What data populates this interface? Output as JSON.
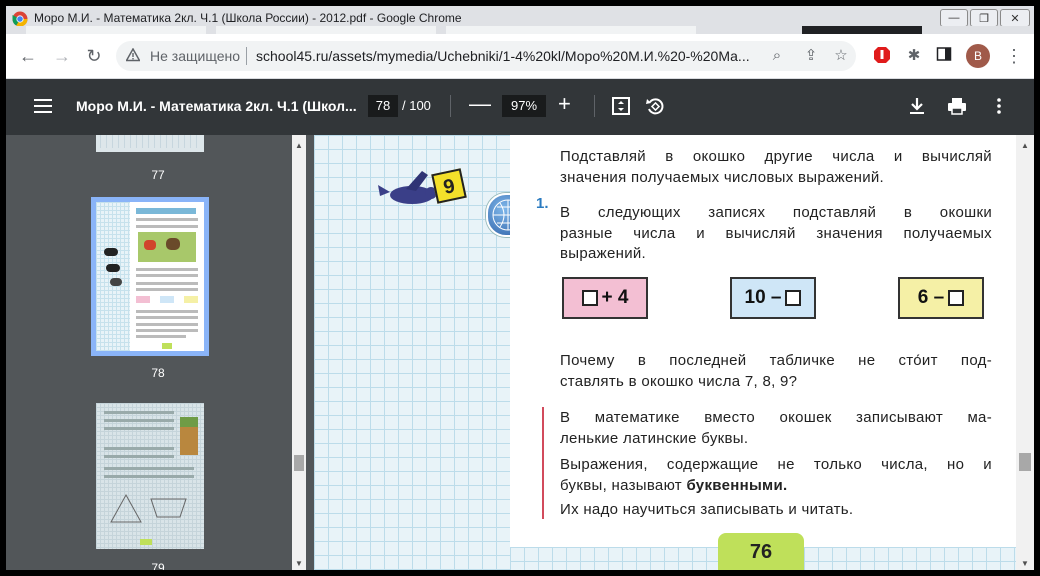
{
  "window": {
    "title": "Моро М.И. - Математика 2кл. Ч.1 (Школа России) - 2012.pdf - Google Chrome",
    "minimize": "—",
    "restore": "❐",
    "close": "✕"
  },
  "address_bar": {
    "security_label": "Не защищено",
    "url": "school45.ru/assets/mymedia/Uchebniki/1-4%20kl/Моро%20М.И.%20-%20Ма...",
    "profile_initial": "В"
  },
  "pdf_toolbar": {
    "doc_title": "Моро М.И. - Математика 2кл. Ч.1 (Школ...",
    "page_current": "78",
    "page_total": "/ 100",
    "zoom": "97%",
    "zoom_minus": "—",
    "zoom_plus": "+"
  },
  "sidebar": {
    "thumbnails": [
      {
        "label": "77"
      },
      {
        "label": "78"
      },
      {
        "label": "79"
      }
    ]
  },
  "page": {
    "intro_line1": "Подставляй в окошко другие числа и вычисляй",
    "intro_line2": "значения получаемых числовых выражений.",
    "task_number": "1.",
    "task_line1": "В следующих записях подставляй в окошки",
    "task_line2": "разные числа и вычисляй значения получаемых",
    "task_line3": "выражений.",
    "expr1": "+ 4",
    "expr2": "10 –",
    "expr3": "6 –",
    "question_line1": "Почему в последней табличке не сто́ит под-",
    "question_line2": "ставлять в окошко числа 7, 8, 9?",
    "rule1_line1": "В математике вместо окошек записывают ма-",
    "rule1_line2": "ленькие латинские буквы.",
    "rule2_line1": "Выражения, содержащие не только числа, но и",
    "rule2_line2_a": "буквы, называют ",
    "rule2_line2_b": "буквенными.",
    "rule3": "Их надо научиться записывать и читать.",
    "bird_badge": "9",
    "page_number": "76"
  },
  "colors": {
    "pdf_toolbar_bg": "#323639",
    "viewer_bg": "#525659",
    "expr1_bg": "#f3bfd3",
    "expr2_bg": "#cfe6f7",
    "expr3_bg": "#f5f0a6",
    "page_number_bg": "#bfe05a"
  }
}
